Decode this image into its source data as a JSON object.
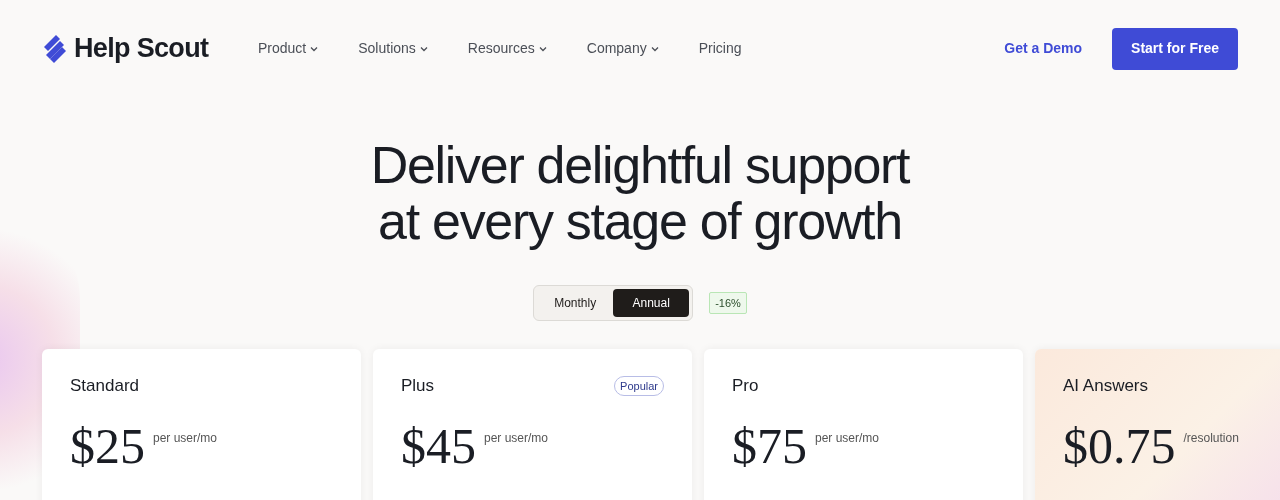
{
  "brand": {
    "name": "Help Scout"
  },
  "nav": [
    {
      "label": "Product",
      "has_menu": true
    },
    {
      "label": "Solutions",
      "has_menu": true
    },
    {
      "label": "Resources",
      "has_menu": true
    },
    {
      "label": "Company",
      "has_menu": true
    },
    {
      "label": "Pricing",
      "has_menu": false
    }
  ],
  "actions": {
    "demo": "Get a Demo",
    "start": "Start for Free"
  },
  "headline": [
    "Deliver delightful support",
    "at every stage of growth"
  ],
  "billing": {
    "options": [
      {
        "label": "Monthly",
        "selected": false
      },
      {
        "label": "Annual",
        "selected": true
      }
    ],
    "discount": "-16%"
  },
  "plans": [
    {
      "kind": "plan",
      "name": "Standard",
      "price": "$25",
      "unit": "per user/mo"
    },
    {
      "kind": "plan",
      "name": "Plus",
      "price": "$45",
      "unit": "per user/mo",
      "badge": "Popular"
    },
    {
      "kind": "plan",
      "name": "Pro",
      "price": "$75",
      "unit": "per user/mo"
    },
    {
      "kind": "addon",
      "name": "AI Answers",
      "price": "$0.75",
      "unit": "/resolution"
    }
  ]
}
